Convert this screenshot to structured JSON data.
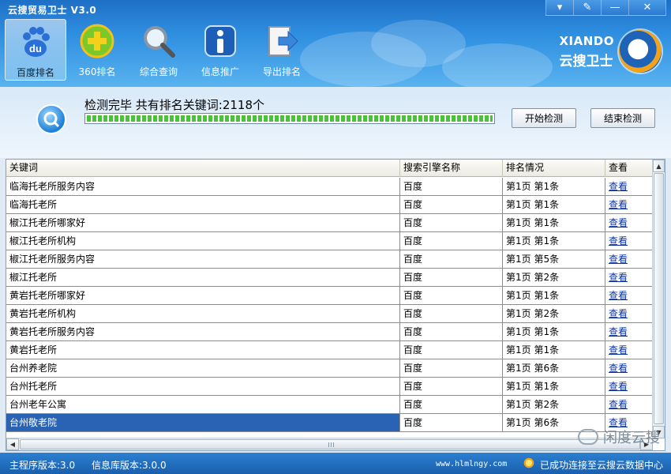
{
  "window": {
    "title": "云搜贸易卫士 V3.0",
    "controls": {
      "menu": "▾",
      "skin": "✎",
      "minimize": "—",
      "close": "✕"
    }
  },
  "toolbar": {
    "items": [
      {
        "label": "百度排名",
        "icon": "baidu-paw-icon",
        "active": true
      },
      {
        "label": "360排名",
        "icon": "plus-360-icon",
        "active": false
      },
      {
        "label": "综合查询",
        "icon": "magnifier-icon",
        "active": false
      },
      {
        "label": "信息推广",
        "icon": "info-icon",
        "active": false
      },
      {
        "label": "导出排名",
        "icon": "export-icon",
        "active": false
      }
    ]
  },
  "brand": {
    "en": "XIANDO",
    "cn": "云搜卫士"
  },
  "scan": {
    "status": "检测完毕 共有排名关键词:2118个",
    "progress": 1.0,
    "start_button": "开始检测",
    "stop_button": "结束检测"
  },
  "table": {
    "headers": [
      "关键词",
      "搜索引擎名称",
      "排名情况",
      "查看"
    ],
    "rows": [
      {
        "keyword": "临海托老所服务内容",
        "engine": "百度",
        "rank": "第1页 第1条",
        "view": "查看"
      },
      {
        "keyword": "临海托老所",
        "engine": "百度",
        "rank": "第1页 第1条",
        "view": "查看"
      },
      {
        "keyword": "椒江托老所哪家好",
        "engine": "百度",
        "rank": "第1页 第1条",
        "view": "查看"
      },
      {
        "keyword": "椒江托老所机构",
        "engine": "百度",
        "rank": "第1页 第1条",
        "view": "查看"
      },
      {
        "keyword": "椒江托老所服务内容",
        "engine": "百度",
        "rank": "第1页 第5条",
        "view": "查看"
      },
      {
        "keyword": "椒江托老所",
        "engine": "百度",
        "rank": "第1页 第2条",
        "view": "查看"
      },
      {
        "keyword": "黄岩托老所哪家好",
        "engine": "百度",
        "rank": "第1页 第1条",
        "view": "查看"
      },
      {
        "keyword": "黄岩托老所机构",
        "engine": "百度",
        "rank": "第1页 第2条",
        "view": "查看"
      },
      {
        "keyword": "黄岩托老所服务内容",
        "engine": "百度",
        "rank": "第1页 第1条",
        "view": "查看"
      },
      {
        "keyword": "黄岩托老所",
        "engine": "百度",
        "rank": "第1页 第1条",
        "view": "查看"
      },
      {
        "keyword": "台州养老院",
        "engine": "百度",
        "rank": "第1页 第6条",
        "view": "查看"
      },
      {
        "keyword": "台州托老所",
        "engine": "百度",
        "rank": "第1页 第1条",
        "view": "查看"
      },
      {
        "keyword": "台州老年公寓",
        "engine": "百度",
        "rank": "第1页 第2条",
        "view": "查看"
      },
      {
        "keyword": "台州敬老院",
        "engine": "百度",
        "rank": "第1页 第6条",
        "view": "查看",
        "selected": true
      }
    ]
  },
  "watermark": "闲度云搜",
  "statusbar": {
    "main_version": "主程序版本:3.0",
    "db_version": "信息库版本:3.0.0",
    "url": "www.hlmlngy.com",
    "connection": "已成功连接至云搜云数据中心"
  },
  "colors": {
    "accent": "#2f8fe0",
    "selected_row": "#2a62b4",
    "progress": "#4cc23b",
    "link": "#0a33a8"
  }
}
